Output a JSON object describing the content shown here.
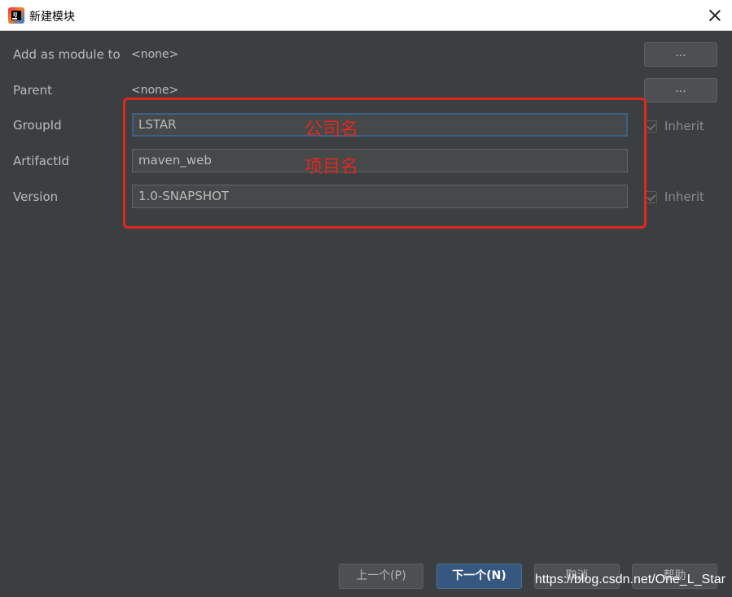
{
  "window": {
    "title": "新建模块",
    "icon": "intellij-idea-icon"
  },
  "rows": {
    "add_as_module_to": {
      "label": "Add as module to",
      "value": "<none>",
      "button": "..."
    },
    "parent": {
      "label": "Parent",
      "value": "<none>",
      "button": "..."
    },
    "group_id": {
      "label": "GroupId",
      "value": "LSTAR",
      "inherit_label": "Inherit",
      "inherit_checked": true
    },
    "artifact_id": {
      "label": "ArtifactId",
      "value": "maven_web"
    },
    "version": {
      "label": "Version",
      "value": "1.0-SNAPSHOT",
      "inherit_label": "Inherit",
      "inherit_checked": true
    }
  },
  "annotations": {
    "company_name": "公司名",
    "project_name": "项目名",
    "color": "#e0281c"
  },
  "footer": {
    "previous": "上一个(P)",
    "next": "下一个(N)",
    "cancel": "取消",
    "help": "帮助"
  },
  "watermark": "https://blog.csdn.net/One_L_Star",
  "colors": {
    "background": "#3c3f41",
    "primary_button": "#365880",
    "field_background": "#45494a",
    "focus_border": "#3d6185"
  }
}
